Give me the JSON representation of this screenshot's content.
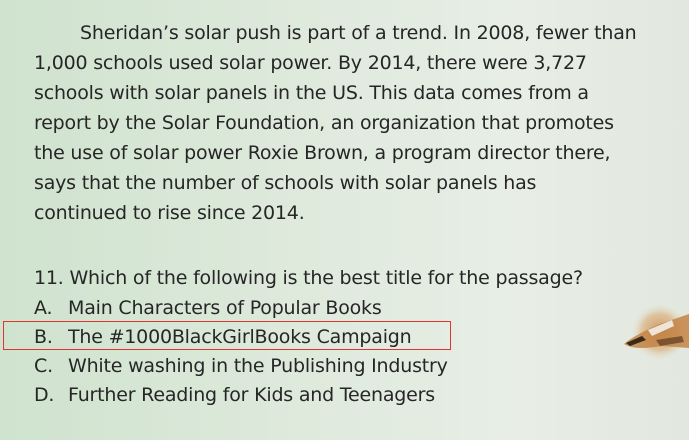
{
  "passage": {
    "lines": [
      "Sheridan’s solar push is part of a trend. In 2008, fewer than",
      "1,000 schools used solar power. By 2014, there were 3,727",
      "schools with solar panels in the US. This data comes from a",
      "report by the Solar Foundation, an organization that promotes",
      "the use of solar power Roxie Brown, a program director there,",
      "says that the number of schools with solar panels has",
      "continued to rise since 2014."
    ]
  },
  "question": {
    "text": "11. Which of the following is the best title for the passage?"
  },
  "options": [
    {
      "letter": "A.",
      "text": "Main Characters of Popular Books"
    },
    {
      "letter": "B.",
      "text": "The #1000BlackGirlBooks Campaign"
    },
    {
      "letter": "C.",
      "text": "White washing in the Publishing Industry"
    },
    {
      "letter": "D.",
      "text": "Further Reading for Kids and Teenagers"
    }
  ],
  "highlight": {
    "selected_option": "B.",
    "color": "#e0342e"
  },
  "colors": {
    "background": "#dde9db",
    "text": "#262626"
  }
}
